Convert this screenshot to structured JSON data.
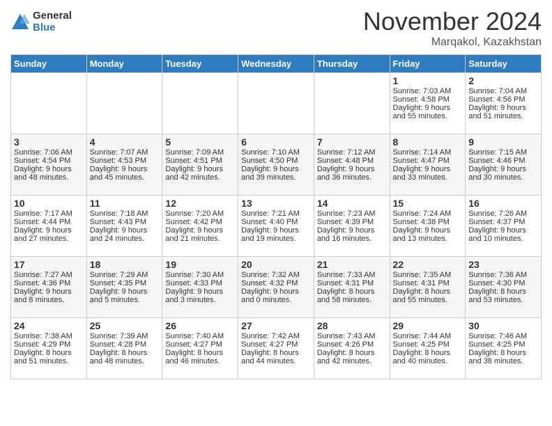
{
  "header": {
    "logo_general": "General",
    "logo_blue": "Blue",
    "month_title": "November 2024",
    "location": "Marqakol, Kazakhstan"
  },
  "weekdays": [
    "Sunday",
    "Monday",
    "Tuesday",
    "Wednesday",
    "Thursday",
    "Friday",
    "Saturday"
  ],
  "weeks": [
    [
      {
        "day": "",
        "info": ""
      },
      {
        "day": "",
        "info": ""
      },
      {
        "day": "",
        "info": ""
      },
      {
        "day": "",
        "info": ""
      },
      {
        "day": "",
        "info": ""
      },
      {
        "day": "1",
        "info": "Sunrise: 7:03 AM\nSunset: 4:58 PM\nDaylight: 9 hours\nand 55 minutes."
      },
      {
        "day": "2",
        "info": "Sunrise: 7:04 AM\nSunset: 4:56 PM\nDaylight: 9 hours\nand 51 minutes."
      }
    ],
    [
      {
        "day": "3",
        "info": "Sunrise: 7:06 AM\nSunset: 4:54 PM\nDaylight: 9 hours\nand 48 minutes."
      },
      {
        "day": "4",
        "info": "Sunrise: 7:07 AM\nSunset: 4:53 PM\nDaylight: 9 hours\nand 45 minutes."
      },
      {
        "day": "5",
        "info": "Sunrise: 7:09 AM\nSunset: 4:51 PM\nDaylight: 9 hours\nand 42 minutes."
      },
      {
        "day": "6",
        "info": "Sunrise: 7:10 AM\nSunset: 4:50 PM\nDaylight: 9 hours\nand 39 minutes."
      },
      {
        "day": "7",
        "info": "Sunrise: 7:12 AM\nSunset: 4:48 PM\nDaylight: 9 hours\nand 36 minutes."
      },
      {
        "day": "8",
        "info": "Sunrise: 7:14 AM\nSunset: 4:47 PM\nDaylight: 9 hours\nand 33 minutes."
      },
      {
        "day": "9",
        "info": "Sunrise: 7:15 AM\nSunset: 4:46 PM\nDaylight: 9 hours\nand 30 minutes."
      }
    ],
    [
      {
        "day": "10",
        "info": "Sunrise: 7:17 AM\nSunset: 4:44 PM\nDaylight: 9 hours\nand 27 minutes."
      },
      {
        "day": "11",
        "info": "Sunrise: 7:18 AM\nSunset: 4:43 PM\nDaylight: 9 hours\nand 24 minutes."
      },
      {
        "day": "12",
        "info": "Sunrise: 7:20 AM\nSunset: 4:42 PM\nDaylight: 9 hours\nand 21 minutes."
      },
      {
        "day": "13",
        "info": "Sunrise: 7:21 AM\nSunset: 4:40 PM\nDaylight: 9 hours\nand 19 minutes."
      },
      {
        "day": "14",
        "info": "Sunrise: 7:23 AM\nSunset: 4:39 PM\nDaylight: 9 hours\nand 16 minutes."
      },
      {
        "day": "15",
        "info": "Sunrise: 7:24 AM\nSunset: 4:38 PM\nDaylight: 9 hours\nand 13 minutes."
      },
      {
        "day": "16",
        "info": "Sunrise: 7:26 AM\nSunset: 4:37 PM\nDaylight: 9 hours\nand 10 minutes."
      }
    ],
    [
      {
        "day": "17",
        "info": "Sunrise: 7:27 AM\nSunset: 4:36 PM\nDaylight: 9 hours\nand 8 minutes."
      },
      {
        "day": "18",
        "info": "Sunrise: 7:29 AM\nSunset: 4:35 PM\nDaylight: 9 hours\nand 5 minutes."
      },
      {
        "day": "19",
        "info": "Sunrise: 7:30 AM\nSunset: 4:33 PM\nDaylight: 9 hours\nand 3 minutes."
      },
      {
        "day": "20",
        "info": "Sunrise: 7:32 AM\nSunset: 4:32 PM\nDaylight: 9 hours\nand 0 minutes."
      },
      {
        "day": "21",
        "info": "Sunrise: 7:33 AM\nSunset: 4:31 PM\nDaylight: 8 hours\nand 58 minutes."
      },
      {
        "day": "22",
        "info": "Sunrise: 7:35 AM\nSunset: 4:31 PM\nDaylight: 8 hours\nand 55 minutes."
      },
      {
        "day": "23",
        "info": "Sunrise: 7:36 AM\nSunset: 4:30 PM\nDaylight: 8 hours\nand 53 minutes."
      }
    ],
    [
      {
        "day": "24",
        "info": "Sunrise: 7:38 AM\nSunset: 4:29 PM\nDaylight: 8 hours\nand 51 minutes."
      },
      {
        "day": "25",
        "info": "Sunrise: 7:39 AM\nSunset: 4:28 PM\nDaylight: 8 hours\nand 48 minutes."
      },
      {
        "day": "26",
        "info": "Sunrise: 7:40 AM\nSunset: 4:27 PM\nDaylight: 8 hours\nand 46 minutes."
      },
      {
        "day": "27",
        "info": "Sunrise: 7:42 AM\nSunset: 4:27 PM\nDaylight: 8 hours\nand 44 minutes."
      },
      {
        "day": "28",
        "info": "Sunrise: 7:43 AM\nSunset: 4:26 PM\nDaylight: 8 hours\nand 42 minutes."
      },
      {
        "day": "29",
        "info": "Sunrise: 7:44 AM\nSunset: 4:25 PM\nDaylight: 8 hours\nand 40 minutes."
      },
      {
        "day": "30",
        "info": "Sunrise: 7:46 AM\nSunset: 4:25 PM\nDaylight: 8 hours\nand 38 minutes."
      }
    ]
  ]
}
